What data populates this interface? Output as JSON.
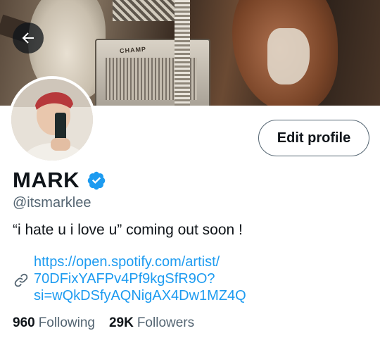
{
  "banner": {
    "amp_label": "CHAMP"
  },
  "profile": {
    "name": "MARK",
    "handle": "@itsmarklee",
    "bio": "“i hate u i love u” coming out soon !",
    "link_lines": [
      "https://open.spotify.com/artist/",
      "70DFixYAFPv4Pf9kgSfR9O?",
      "si=wQkDSfyAQNigAX4Dw1MZ4Q"
    ],
    "following_count": "960",
    "following_label": "Following",
    "followers_count": "29K",
    "followers_label": "Followers"
  },
  "actions": {
    "edit_profile": "Edit profile"
  },
  "icons": {
    "back": "arrow-left-icon",
    "verified": "verified-badge-icon",
    "link": "link-icon"
  },
  "colors": {
    "accent": "#1d9bf0",
    "text_primary": "#0f1419",
    "text_secondary": "#536471"
  }
}
